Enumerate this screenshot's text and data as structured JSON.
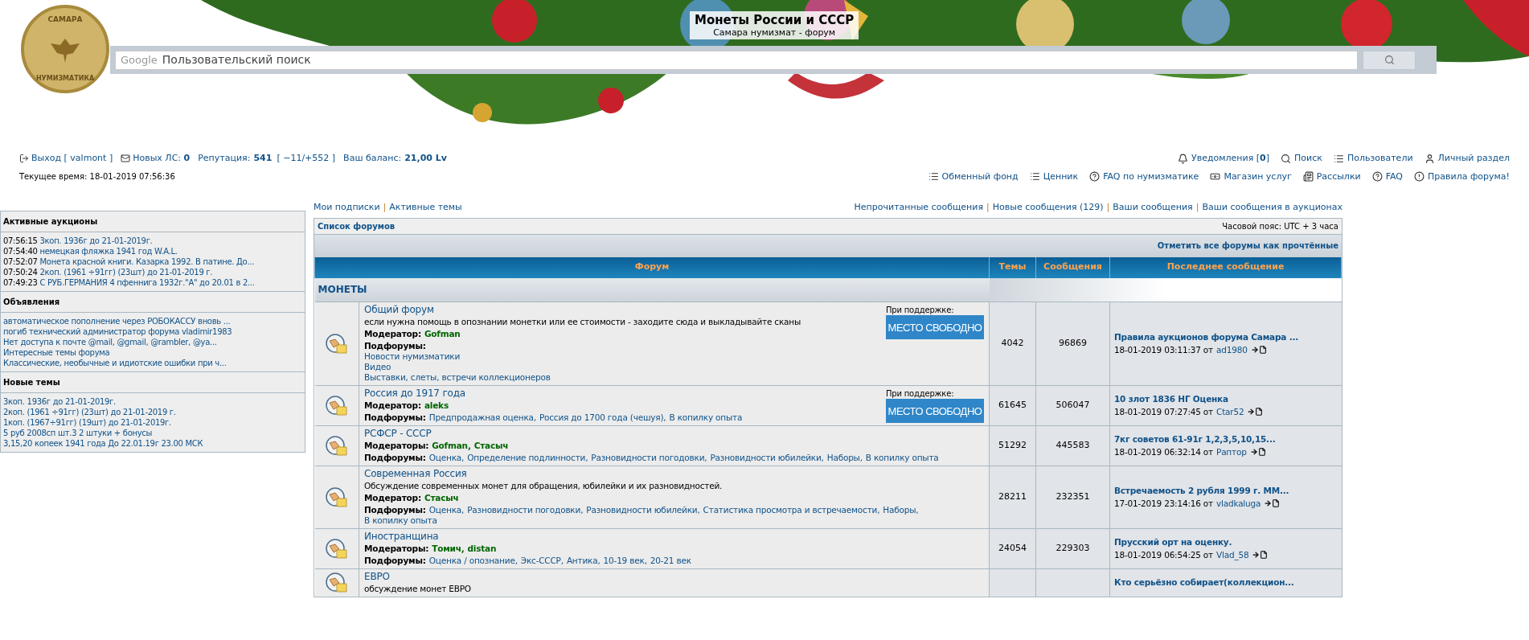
{
  "header": {
    "title": "Монеты России и СССР",
    "subtitle": "Самара нумизмат - форум",
    "logo": {
      "top": "САМАРА",
      "bottom": "НУМИЗМАТИКА"
    },
    "search": {
      "brand": "Google",
      "placeholder": "Пользовательский поиск"
    }
  },
  "user_bar": {
    "logout": "Выход [ valmont ]",
    "new_pm": "Новых ЛС: **0**",
    "reputation_label": "Репутация:",
    "reputation": "541",
    "reputation_detail": "[ −11/+552 ]",
    "balance_label": "Ваш баланс:",
    "balance": "21,00 Lv",
    "current_time": "Текущее время: 18-01-2019 07:56:36"
  },
  "top_links": [
    [
      {
        "kind": "bell",
        "label": "Уведомления [**0**]"
      },
      {
        "kind": "search",
        "label": "Поиск"
      },
      {
        "kind": "list",
        "label": "Пользователи"
      },
      {
        "kind": "user",
        "label": "Личный раздел"
      }
    ],
    [
      {
        "kind": "list",
        "label": "Обменный фонд"
      },
      {
        "kind": "list",
        "label": "Ценник"
      },
      {
        "kind": "help",
        "label": "FAQ по нумизматике"
      },
      {
        "kind": "money",
        "label": "Магазин услуг"
      },
      {
        "kind": "news",
        "label": "Рассылки"
      },
      {
        "kind": "help",
        "label": "FAQ"
      },
      {
        "kind": "alert",
        "label": "Правила форума!"
      }
    ]
  ],
  "nav_left": [
    {
      "kind": "link",
      "text": "Мои подписки"
    },
    {
      "kind": "separator",
      "text": "|"
    },
    {
      "kind": "link",
      "text": "Активные темы"
    }
  ],
  "nav_right": [
    {
      "kind": "link",
      "text": "Непрочитанные сообщения"
    },
    {
      "kind": "separator",
      "text": "|"
    },
    {
      "kind": "link",
      "text": "Новые сообщения (129)"
    },
    {
      "kind": "separator",
      "text": "|"
    },
    {
      "kind": "link",
      "text": "Ваши сообщения"
    },
    {
      "kind": "separator",
      "text": "|"
    },
    {
      "kind": "link",
      "text": "Ваши сообщения в аукционах"
    }
  ],
  "sidebar": [
    {
      "title": "Активные аукционы",
      "items": [
        {
          "time": "07:56:15",
          "text": "3коп. 1936г до 21-01-2019г."
        },
        {
          "time": "07:54:40",
          "text": "немецкая фляжка 1941 год W.A.L."
        },
        {
          "time": "07:52:07",
          "text": "Монета красной книги. Казарка 1992. В патине. До..."
        },
        {
          "time": "07:50:24",
          "text": "2коп. (1961 ÷91гг) (23шт) до 21-01-2019 г."
        },
        {
          "time": "07:49:23",
          "text": "С РУБ.ГЕРМАНИЯ 4 пфеннига 1932г.\"A\" до 20.01 в 2..."
        }
      ]
    },
    {
      "title": "Объявления",
      "items": [
        {
          "text": "автоматическое пополнение через РОБОКАССУ вновь ..."
        },
        {
          "text": "погиб технический администратор форума vladimir1983"
        },
        {
          "text": "Нет доступа к почте @mail, @gmail, @rambler, @ya..."
        },
        {
          "text": "Интересные темы форума"
        },
        {
          "text": "Классические, необычные и идиотские ошибки при ч..."
        }
      ]
    },
    {
      "title": "Новые темы",
      "items": [
        {
          "text": "3коп. 1936г до 21-01-2019г."
        },
        {
          "text": "2коп. (1961 ÷91гг) (23шт) до 21-01-2019 г."
        },
        {
          "text": "1коп. (1967÷91гг) (19шт) до 21-01-2019г."
        },
        {
          "text": "5 руб 2008сп шт.3 2 штуки + бонусы"
        },
        {
          "text": "3,15,20 копеек 1941 года До 22.01.19г 23.00 МСК"
        }
      ]
    }
  ],
  "forum_table": {
    "breadcrumb": "Список форумов",
    "timezone": "Часовой пояс: UTC + 3 часа",
    "mark_read": "Отметить все форумы как прочтённые",
    "columns": [
      "Форум",
      "Темы",
      "Сообщения",
      "Последнее сообщение"
    ],
    "category": "МОНЕТЫ",
    "forums": [
      {
        "title": "Общий форум",
        "description": "если нужна помощь в опознании монетки или ее стоимости - заходите сюда и выкладывайте сканы",
        "moderator_label": "Модератор:",
        "moderators": [
          "Gofman"
        ],
        "subforums_label": "Подфорумы:",
        "kind": "list",
        "subforums": [
          "Новости нумизматики",
          "Видео",
          "Выставки, слеты, встречи коллекционеров"
        ],
        "sponsor": {
          "label": "При поддержке:",
          "banner": "МЕСТО СВОБОДНО"
        },
        "topics": "4042",
        "posts": "96869",
        "last_post": {
          "title": "Правила аукционов форума Самара ...",
          "date": "18-01-2019 03:11:37 от",
          "author": "ad1980"
        }
      },
      {
        "title": "Россия до 1917 года",
        "moderator_label": "Модератор:",
        "moderators": [
          "aleks"
        ],
        "subforums_label": "Подфорумы:",
        "kind": "inline",
        "subforums": [
          "Предпродажная оценка,",
          "Россия до 1700 года (чешуя),",
          "В копилку опыта"
        ],
        "sponsor": {
          "label": "При поддержке:",
          "banner": "МЕСТО СВОБОДНО"
        },
        "topics": "61645",
        "posts": "506047",
        "last_post": {
          "title": "10 злот 1836 НГ Оценка",
          "date": "18-01-2019 07:27:45 от",
          "author": "Ctar52"
        }
      },
      {
        "title": "РСФСР - СССР",
        "moderator_label": "Модераторы:",
        "moderators": [
          "Gofman,",
          "Стасыч"
        ],
        "subforums_label": "Подфорумы:",
        "kind": "inline",
        "subforums": [
          "Оценка,",
          "Определение подлинности,",
          "Разновидности погодовки,",
          "Разновидности юбилейки,",
          "Наборы,",
          "В копилку опыта"
        ],
        "topics": "51292",
        "posts": "445583",
        "last_post": {
          "title": "7кг советов 61-91г 1,2,3,5,10,15...",
          "date": "18-01-2019 06:32:14 от",
          "author": "Раптор"
        }
      },
      {
        "title": "Современная Россия",
        "description": "Обсуждение современных монет для обращения, юбилейки и их разновидностей.",
        "moderator_label": "Модератор:",
        "moderators": [
          "Стасыч"
        ],
        "subforums_label": "Подфорумы:",
        "kind": "inline",
        "subforums": [
          "Оценка,",
          "Разновидности погодовки,",
          "Разновидности юбилейки,",
          "Статистика просмотра и встречаемости,",
          "Наборы,",
          "В копилку опыта"
        ],
        "topics": "28211",
        "posts": "232351",
        "last_post": {
          "title": "Встречаемость 2 рубля 1999 г. ММ...",
          "date": "17-01-2019 23:14:16 от",
          "author": "vladkaluga"
        }
      },
      {
        "title": "Иностранщина",
        "moderator_label": "Модераторы:",
        "moderators": [
          "Томич,",
          "distan"
        ],
        "subforums_label": "Подфорумы:",
        "kind": "inline",
        "subforums": [
          "Оценка / опознание,",
          "Экс-СССР,",
          "Антика,",
          "10-19 век,",
          "20-21 век"
        ],
        "topics": "24054",
        "posts": "229303",
        "last_post": {
          "title": "Прусский орт на оценку.",
          "date": "18-01-2019 06:54:25 от",
          "author": "Vlad_58"
        }
      },
      {
        "title": "ЕВРО",
        "description": "обсуждение монет ЕВРО",
        "last_post": {
          "title": "Кто серьёзно собирает(коллекцион..."
        }
      }
    ]
  }
}
